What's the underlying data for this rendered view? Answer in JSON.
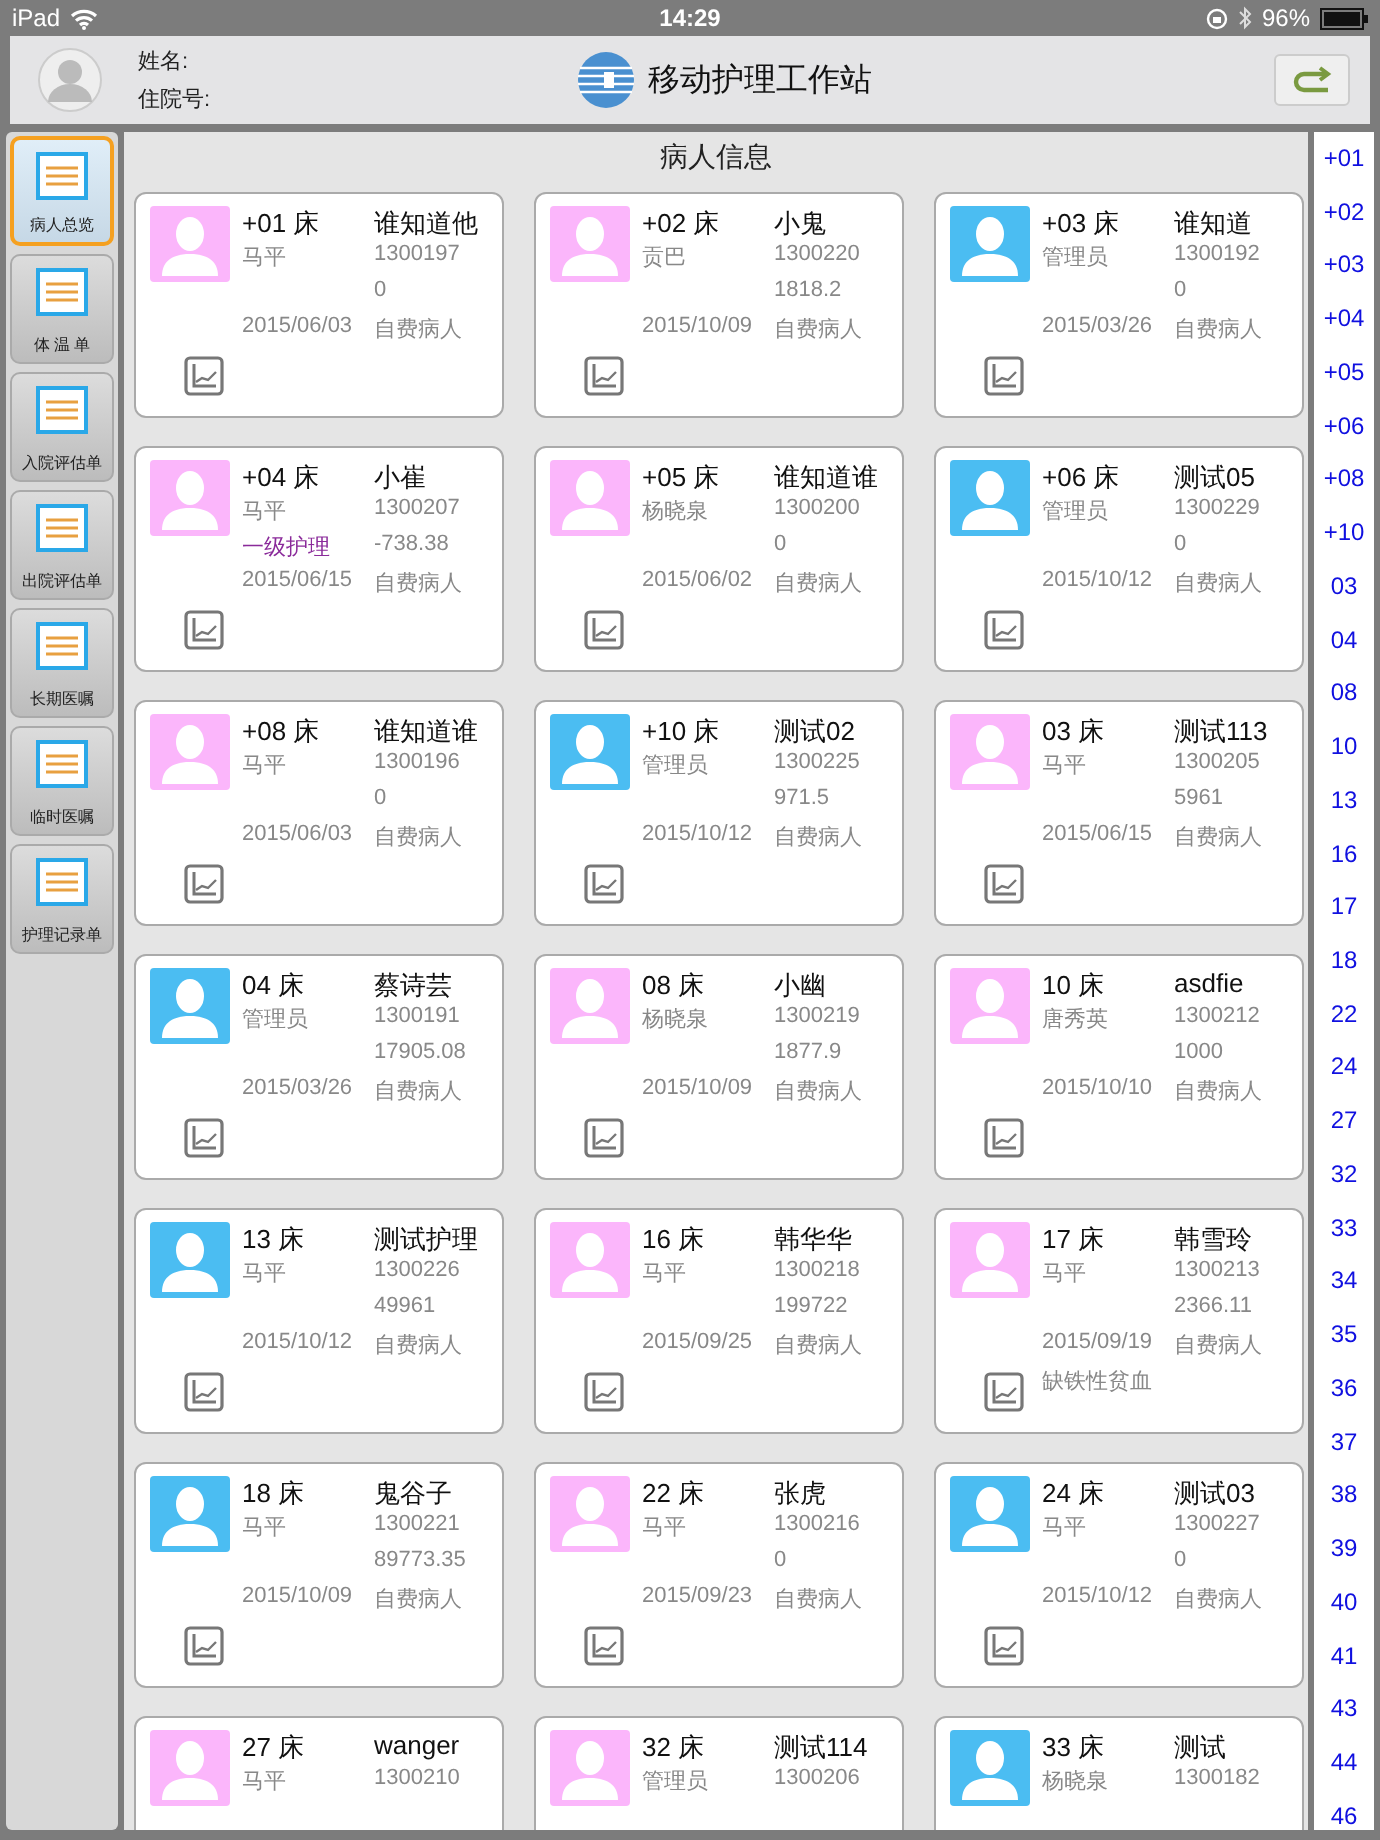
{
  "status_bar": {
    "device": "iPad",
    "time": "14:29",
    "battery": "96%"
  },
  "header": {
    "name_label": "姓名:",
    "admission_label": "住院号:",
    "title": "移动护理工作站"
  },
  "sidebar": {
    "items": [
      {
        "label": "病人总览",
        "selected": true
      },
      {
        "label": "体 温 单",
        "selected": false
      },
      {
        "label": "入院评估单",
        "selected": false
      },
      {
        "label": "出院评估单",
        "selected": false
      },
      {
        "label": "长期医嘱",
        "selected": false
      },
      {
        "label": "临时医嘱",
        "selected": false
      },
      {
        "label": "护理记录单",
        "selected": false
      }
    ]
  },
  "panel": {
    "title": "病人信息"
  },
  "patients": [
    {
      "bed": "+01 床",
      "name": "谁知道他",
      "nurse": "马平",
      "id": "1300197",
      "balance": "0",
      "date": "2015/06/03",
      "fee_type": "自费病人",
      "color": "#fbb6fb"
    },
    {
      "bed": "+02 床",
      "name": "小鬼",
      "nurse": "贡巴",
      "id": "1300220",
      "balance": "1818.2",
      "date": "2015/10/09",
      "fee_type": "自费病人",
      "color": "#fbb6fb"
    },
    {
      "bed": "+03 床",
      "name": "谁知道",
      "nurse": "管理员",
      "id": "1300192",
      "balance": "0",
      "date": "2015/03/26",
      "fee_type": "自费病人",
      "color": "#4bbdf2"
    },
    {
      "bed": "+04 床",
      "name": "小崔",
      "nurse": "马平",
      "id": "1300207",
      "care_level": "一级护理",
      "balance": "-738.38",
      "date": "2015/06/15",
      "fee_type": "自费病人",
      "color": "#fbb6fb"
    },
    {
      "bed": "+05 床",
      "name": "谁知道谁",
      "nurse": "杨晓泉",
      "id": "1300200",
      "balance": "0",
      "date": "2015/06/02",
      "fee_type": "自费病人",
      "color": "#fbb6fb"
    },
    {
      "bed": "+06 床",
      "name": "测试05",
      "nurse": "管理员",
      "id": "1300229",
      "balance": "0",
      "date": "2015/10/12",
      "fee_type": "自费病人",
      "color": "#4bbdf2"
    },
    {
      "bed": "+08 床",
      "name": "谁知道谁",
      "nurse": "马平",
      "id": "1300196",
      "balance": "0",
      "date": "2015/06/03",
      "fee_type": "自费病人",
      "color": "#fbb6fb"
    },
    {
      "bed": "+10 床",
      "name": "测试02",
      "nurse": "管理员",
      "id": "1300225",
      "balance": "971.5",
      "date": "2015/10/12",
      "fee_type": "自费病人",
      "color": "#4bbdf2"
    },
    {
      "bed": "03 床",
      "name": "测试113",
      "nurse": "马平",
      "id": "1300205",
      "balance": "5961",
      "date": "2015/06/15",
      "fee_type": "自费病人",
      "color": "#fbb6fb"
    },
    {
      "bed": "04 床",
      "name": "蔡诗芸",
      "nurse": "管理员",
      "id": "1300191",
      "balance": "17905.08",
      "date": "2015/03/26",
      "fee_type": "自费病人",
      "color": "#4bbdf2"
    },
    {
      "bed": "08 床",
      "name": "小幽",
      "nurse": "杨晓泉",
      "id": "1300219",
      "balance": "1877.9",
      "date": "2015/10/09",
      "fee_type": "自费病人",
      "color": "#fbb6fb"
    },
    {
      "bed": "10 床",
      "name": "asdfie",
      "nurse": "唐秀英",
      "id": "1300212",
      "balance": "1000",
      "date": "2015/10/10",
      "fee_type": "自费病人",
      "color": "#fbb6fb"
    },
    {
      "bed": "13 床",
      "name": "测试护理",
      "nurse": "马平",
      "id": "1300226",
      "balance": "49961",
      "date": "2015/10/12",
      "fee_type": "自费病人",
      "color": "#4bbdf2"
    },
    {
      "bed": "16 床",
      "name": "韩华华",
      "nurse": "马平",
      "id": "1300218",
      "balance": "199722",
      "date": "2015/09/25",
      "fee_type": "自费病人",
      "color": "#fbb6fb"
    },
    {
      "bed": "17 床",
      "name": "韩雪玲",
      "nurse": "马平",
      "id": "1300213",
      "balance": "2366.11",
      "date": "2015/09/19",
      "fee_type": "自费病人",
      "diagnosis": "缺铁性贫血",
      "color": "#fbb6fb"
    },
    {
      "bed": "18 床",
      "name": "鬼谷子",
      "nurse": "马平",
      "id": "1300221",
      "balance": "89773.35",
      "date": "2015/10/09",
      "fee_type": "自费病人",
      "color": "#4bbdf2"
    },
    {
      "bed": "22 床",
      "name": "张虎",
      "nurse": "马平",
      "id": "1300216",
      "balance": "0",
      "date": "2015/09/23",
      "fee_type": "自费病人",
      "color": "#fbb6fb"
    },
    {
      "bed": "24 床",
      "name": "测试03",
      "nurse": "马平",
      "id": "1300227",
      "balance": "0",
      "date": "2015/10/12",
      "fee_type": "自费病人",
      "color": "#4bbdf2"
    },
    {
      "bed": "27 床",
      "name": "wanger",
      "nurse": "马平",
      "id": "1300210",
      "color": "#fbb6fb"
    },
    {
      "bed": "32 床",
      "name": "测试114",
      "nurse": "管理员",
      "id": "1300206",
      "color": "#fbb6fb"
    },
    {
      "bed": "33 床",
      "name": "测试",
      "nurse": "杨晓泉",
      "id": "1300182",
      "color": "#4bbdf2"
    }
  ],
  "bed_index": [
    "+01",
    "+02",
    "+03",
    "+04",
    "+05",
    "+06",
    "+08",
    "+10",
    "03",
    "04",
    "08",
    "10",
    "13",
    "16",
    "17",
    "18",
    "22",
    "24",
    "27",
    "32",
    "33",
    "34",
    "35",
    "36",
    "37",
    "38",
    "39",
    "40",
    "41",
    "43",
    "44",
    "46"
  ]
}
